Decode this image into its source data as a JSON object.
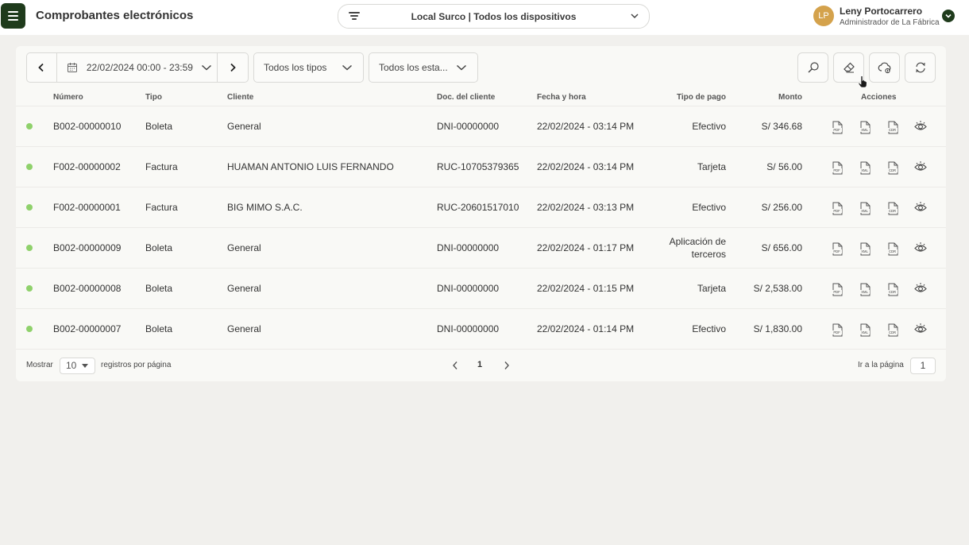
{
  "header": {
    "title": "Comprobantes electrónicos",
    "device_selector": "Local Surco | Todos los dispositivos",
    "user": {
      "initials": "LP",
      "name": "Leny Portocarrero",
      "role": "Administrador de La Fábrica"
    }
  },
  "filters": {
    "date_range": "22/02/2024 00:00 - 23:59",
    "types": "Todos los tipos",
    "states": "Todos los esta..."
  },
  "table": {
    "columns": {
      "numero": "Número",
      "tipo": "Tipo",
      "cliente": "Cliente",
      "doc": "Doc. del cliente",
      "fecha": "Fecha y hora",
      "pago": "Tipo de pago",
      "monto": "Monto",
      "acciones": "Acciones"
    },
    "rows": [
      {
        "numero": "B002-00000010",
        "tipo": "Boleta",
        "cliente": "General",
        "doc": "DNI-00000000",
        "fecha": "22/02/2024 - 03:14 PM",
        "pago": "Efectivo",
        "monto": "S/ 346.68"
      },
      {
        "numero": "F002-00000002",
        "tipo": "Factura",
        "cliente": "HUAMAN ANTONIO LUIS FERNANDO",
        "doc": "RUC-10705379365",
        "fecha": "22/02/2024 - 03:14 PM",
        "pago": "Tarjeta",
        "monto": "S/ 56.00"
      },
      {
        "numero": "F002-00000001",
        "tipo": "Factura",
        "cliente": "BIG MIMO S.A.C.",
        "doc": "RUC-20601517010",
        "fecha": "22/02/2024 - 03:13 PM",
        "pago": "Efectivo",
        "monto": "S/ 256.00"
      },
      {
        "numero": "B002-00000009",
        "tipo": "Boleta",
        "cliente": "General",
        "doc": "DNI-00000000",
        "fecha": "22/02/2024 - 01:17 PM",
        "pago": "Aplicación de",
        "pago2": "terceros",
        "monto": "S/ 656.00"
      },
      {
        "numero": "B002-00000008",
        "tipo": "Boleta",
        "cliente": "General",
        "doc": "DNI-00000000",
        "fecha": "22/02/2024 - 01:15 PM",
        "pago": "Tarjeta",
        "monto": "S/ 2,538.00"
      },
      {
        "numero": "B002-00000007",
        "tipo": "Boleta",
        "cliente": "General",
        "doc": "DNI-00000000",
        "fecha": "22/02/2024 - 01:14 PM",
        "pago": "Efectivo",
        "monto": "S/ 1,830.00"
      }
    ],
    "action_labels": {
      "pdf": "PDF",
      "xml": "XML",
      "cdr": "CDR"
    }
  },
  "pagination": {
    "show_label": "Mostrar",
    "per_page": "10",
    "per_page_suffix": "registros por página",
    "current_page": "1",
    "goto_label": "Ir a la página",
    "goto_value": "1"
  },
  "colors": {
    "brand": "#1f3b1c",
    "status_ok": "#8fd16b",
    "avatar": "#d4a24c"
  }
}
